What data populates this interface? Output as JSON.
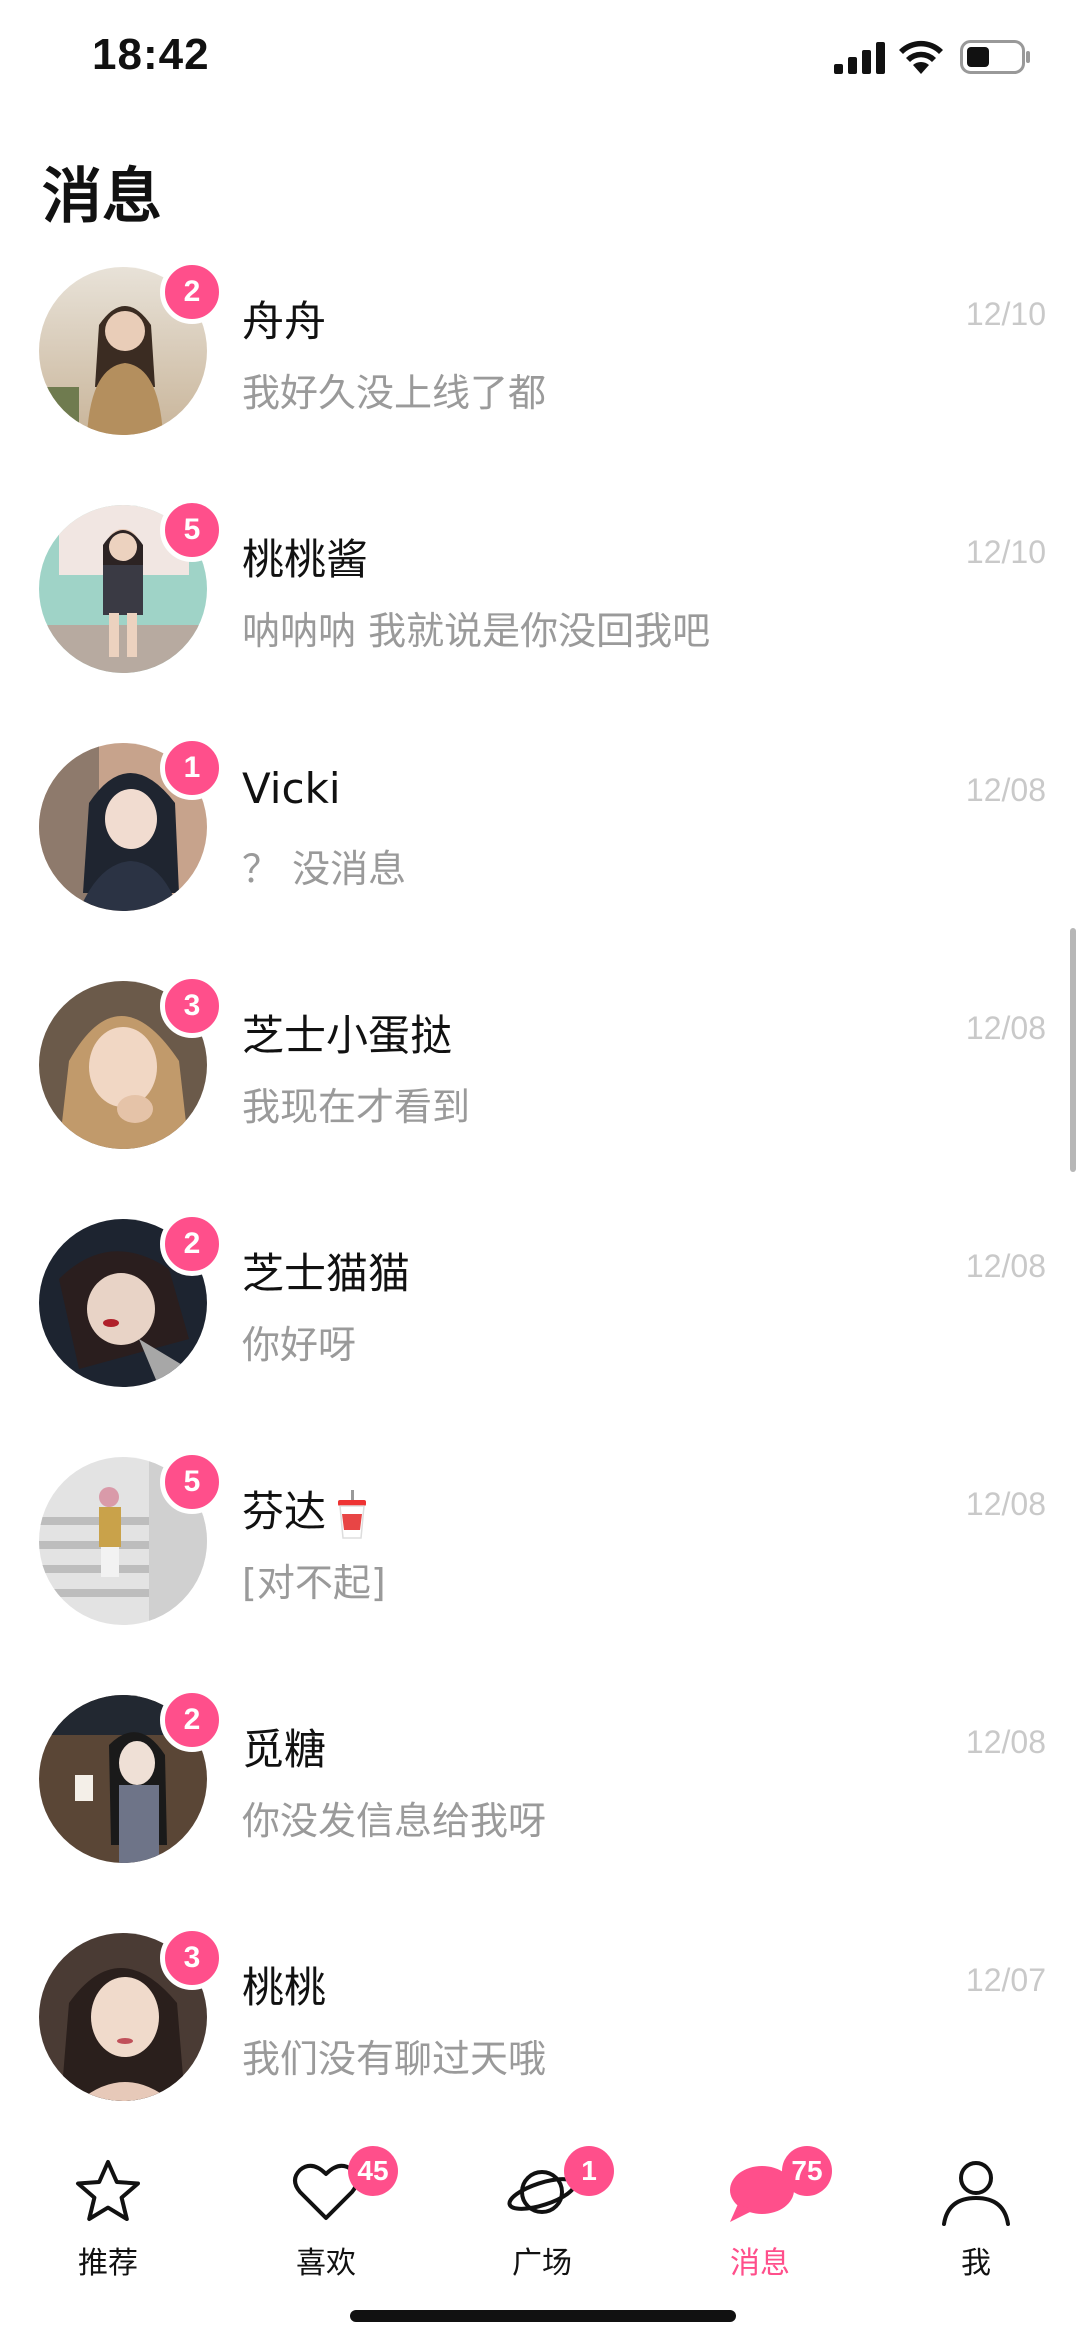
{
  "status_bar": {
    "time": "18:42"
  },
  "header": {
    "title": "消息"
  },
  "conversations": [
    {
      "name": "舟舟",
      "message": "我好久没上线了都",
      "date": "12/10",
      "unread": "2",
      "avatar_colors": [
        "#c9b59a",
        "#6f7b4f"
      ]
    },
    {
      "name": "桃桃酱",
      "message": "呐呐呐 我就说是你没回我吧",
      "date": "12/10",
      "unread": "5",
      "avatar_colors": [
        "#9fd3c7",
        "#3a3a44"
      ]
    },
    {
      "name": "Vicki",
      "message": "？ 没消息",
      "date": "12/08",
      "unread": "1",
      "avatar_colors": [
        "#c7a38c",
        "#2b3344"
      ]
    },
    {
      "name": "芝士小蛋挞",
      "message": "我现在才看到",
      "date": "12/08",
      "unread": "3",
      "avatar_colors": [
        "#6b5a4a",
        "#e5c3a8"
      ]
    },
    {
      "name": "芝士猫猫",
      "message": "你好呀",
      "date": "12/08",
      "unread": "2",
      "avatar_colors": [
        "#1d2430",
        "#d9c0b0"
      ]
    },
    {
      "name": "芬达",
      "message": "[对不起]",
      "date": "12/08",
      "unread": "5",
      "avatar_colors": [
        "#e3e3e3",
        "#8e8e8e"
      ],
      "emoji_icon": "drink-cup-icon"
    },
    {
      "name": "觅糖",
      "message": "你没发信息给我呀",
      "date": "12/08",
      "unread": "2",
      "avatar_colors": [
        "#5a4636",
        "#222831"
      ]
    },
    {
      "name": "桃桃",
      "message": "我们没有聊过天哦",
      "date": "12/07",
      "unread": "3",
      "avatar_colors": [
        "#4a3b34",
        "#e7c9b9"
      ]
    }
  ],
  "tabbar": {
    "active_color": "#ff4f8b",
    "tabs": [
      {
        "label": "推荐",
        "icon": "star-icon",
        "badge": ""
      },
      {
        "label": "喜欢",
        "icon": "heart-icon",
        "badge": "45"
      },
      {
        "label": "广场",
        "icon": "planet-icon",
        "badge": "1"
      },
      {
        "label": "消息",
        "icon": "chat-bubble-icon",
        "badge": "75"
      },
      {
        "label": "我",
        "icon": "person-icon",
        "badge": ""
      }
    ]
  }
}
